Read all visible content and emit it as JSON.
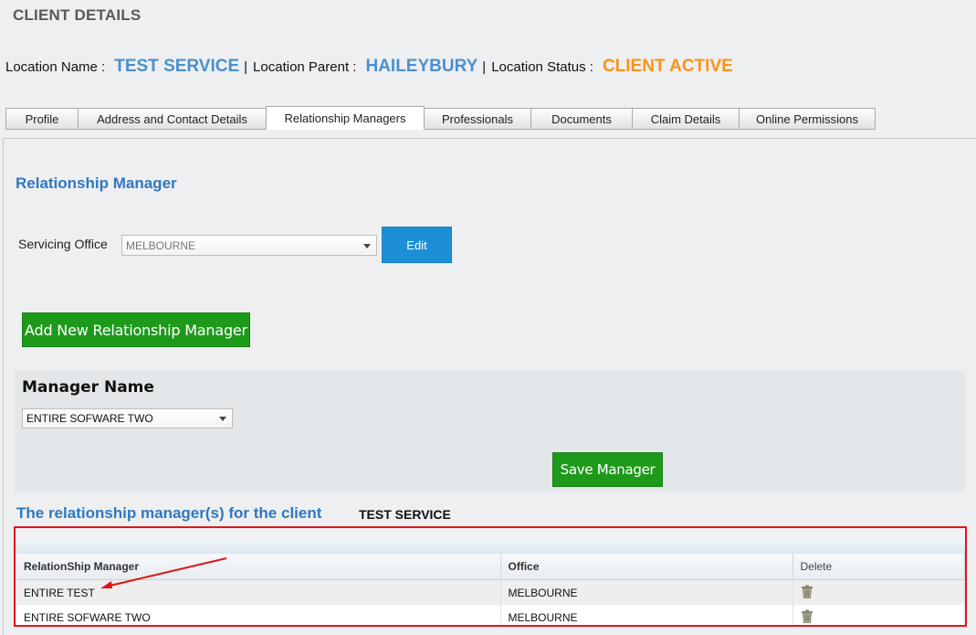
{
  "page": {
    "title": "CLIENT DETAILS"
  },
  "location": {
    "name_label": "Location Name :",
    "name_value": "TEST SERVICE",
    "parent_label": "Location Parent :",
    "parent_value": "HAILEYBURY",
    "status_label": "Location Status :",
    "status_value": "CLIENT ACTIVE",
    "separator": "|"
  },
  "tabs": [
    {
      "label": "Profile",
      "active": false
    },
    {
      "label": "Address and Contact Details",
      "active": false
    },
    {
      "label": "Relationship Managers",
      "active": true
    },
    {
      "label": "Professionals",
      "active": false
    },
    {
      "label": "Documents",
      "active": false
    },
    {
      "label": "Claim Details",
      "active": false
    },
    {
      "label": "Online Permissions",
      "active": false
    }
  ],
  "relationship": {
    "section_title": "Relationship Manager",
    "servicing_office_label": "Servicing Office",
    "servicing_office_value": "MELBOURNE",
    "edit_label": "Edit",
    "add_label": "Add New Relationship Manager",
    "manager_name_label": "Manager Name",
    "manager_name_value": "ENTIRE SOFWARE TWO",
    "save_label": "Save Manager"
  },
  "list": {
    "title": "The relationship manager(s) for the client",
    "client": "TEST SERVICE",
    "columns": [
      "RelationShip Manager",
      "Office",
      "Delete"
    ],
    "rows": [
      {
        "manager": "ENTIRE TEST",
        "office": "MELBOURNE"
      },
      {
        "manager": "ENTIRE SOFWARE TWO",
        "office": "MELBOURNE"
      }
    ]
  },
  "icons": {
    "delete": "trash-icon",
    "dropdown": "chevron-down-icon",
    "annotation": "arrow-annotation"
  },
  "colors": {
    "accent_blue": "#4a90cf",
    "status_orange": "#f7941d",
    "button_green": "#1e9a1b",
    "button_blue": "#1d8fd6",
    "highlight_red": "#e0161b"
  }
}
